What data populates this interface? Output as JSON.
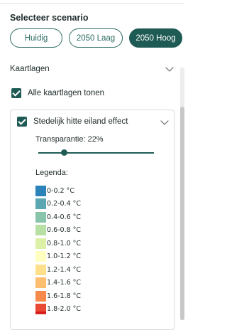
{
  "scenario": {
    "title": "Selecteer scenario",
    "options": [
      "Huidig",
      "2050 Laag",
      "2050 Hoog"
    ],
    "selected": "2050 Hoog"
  },
  "layers": {
    "header": "Kaartlagen",
    "show_all_label": "Alle kaartlagen tonen",
    "item": {
      "label": "Stedelijk hitte eiland effect",
      "transparency_label": "Transparantie: 22%",
      "transparency_value": 22,
      "legend_title": "Legenda:",
      "legend": [
        {
          "label": "0-0.2 °C",
          "color": "#2b83ba"
        },
        {
          "label": "0.2-0.4 °C",
          "color": "#5ba8b3"
        },
        {
          "label": "0.4-0.6 °C",
          "color": "#88c4aa"
        },
        {
          "label": "0.6-0.8 °C",
          "color": "#b7e0a5"
        },
        {
          "label": "0.8-1.0 °C",
          "color": "#dcf0a8"
        },
        {
          "label": "1.0-1.2 °C",
          "color": "#ffffbf"
        },
        {
          "label": "1.2-1.4 °C",
          "color": "#fee08b"
        },
        {
          "label": "1.4-1.6 °C",
          "color": "#fdbf6f"
        },
        {
          "label": "1.6-1.8 °C",
          "color": "#f58a4b"
        },
        {
          "label": "1.8-2.0 °C",
          "color": "#e84a33"
        }
      ]
    }
  },
  "icons": {
    "kaartlagen_toggle": "chevron-down-icon",
    "layer_toggle": "chevron-down-icon",
    "checkbox": "checkmark-icon"
  },
  "colors": {
    "accent": "#1f5b55"
  }
}
